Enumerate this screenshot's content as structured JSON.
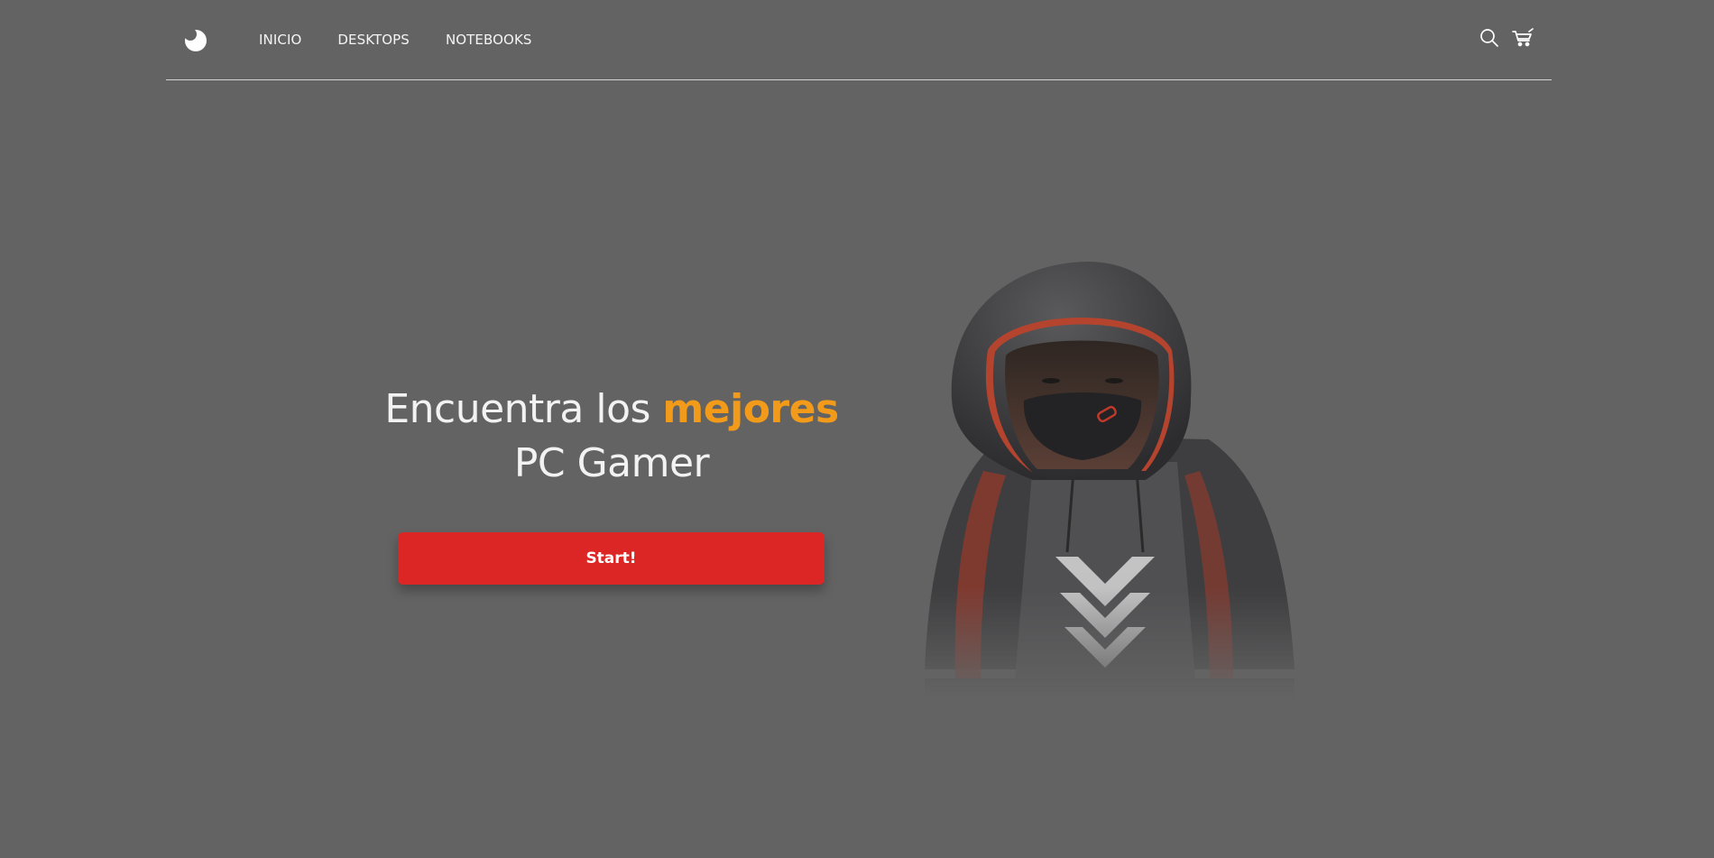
{
  "nav": {
    "logo_icon": "moon-logo-icon",
    "links": [
      {
        "label": "INICIO"
      },
      {
        "label": "DESKTOPS"
      },
      {
        "label": "NOTEBOOKS"
      }
    ],
    "icons": [
      "search-icon",
      "cart-icon"
    ]
  },
  "hero": {
    "title_part1": "Encuentra los",
    "title_highlight": "mejores",
    "title_part2": "PC Gamer",
    "button_label": "Start!",
    "image_subject": "hooded-gamer-illustration"
  },
  "colors": {
    "background": "#636363",
    "accent": "#f29b1a",
    "button": "#dc2626",
    "text": "#f2f2f2"
  }
}
